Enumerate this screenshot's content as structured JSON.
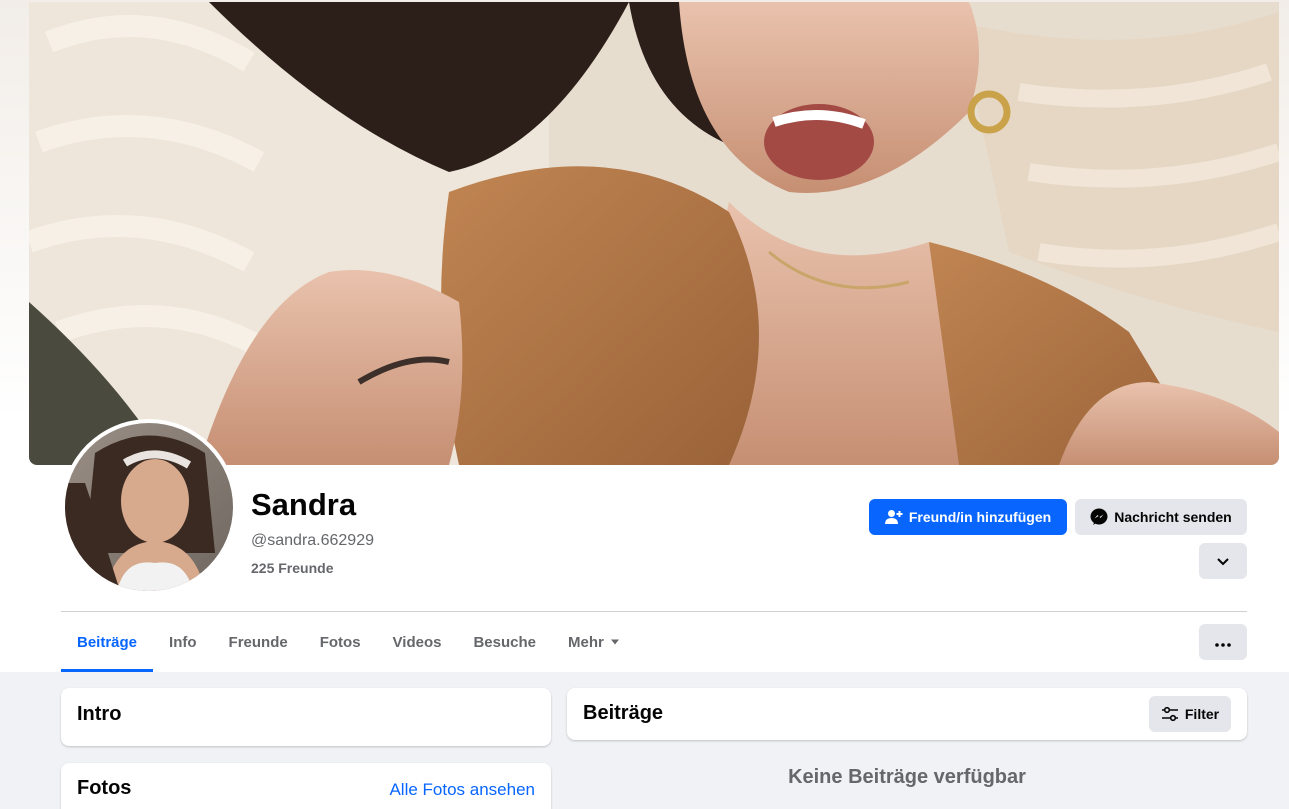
{
  "profile": {
    "name": "Sandra",
    "handle": "@sandra.662929",
    "friends": "225 Freunde"
  },
  "actions": {
    "add_friend": "Freund/in hinzufügen",
    "message": "Nachricht senden"
  },
  "tabs": [
    {
      "label": "Beiträge",
      "active": true
    },
    {
      "label": "Info"
    },
    {
      "label": "Freunde"
    },
    {
      "label": "Fotos"
    },
    {
      "label": "Videos"
    },
    {
      "label": "Besuche"
    },
    {
      "label": "Mehr"
    }
  ],
  "intro": {
    "title": "Intro"
  },
  "photos": {
    "title": "Fotos",
    "see_all": "Alle Fotos ansehen"
  },
  "posts": {
    "title": "Beiträge",
    "filter": "Filter",
    "empty": "Keine Beiträge verfügbar"
  },
  "colors": {
    "primary": "#0866ff",
    "secondary_button": "#e4e6eb",
    "background": "#f0f2f5",
    "muted_text": "#65676b"
  },
  "icons": [
    "add-friend-icon",
    "messenger-icon",
    "chevron-down-icon",
    "caret-down-icon",
    "more-icon",
    "filter-icon"
  ]
}
